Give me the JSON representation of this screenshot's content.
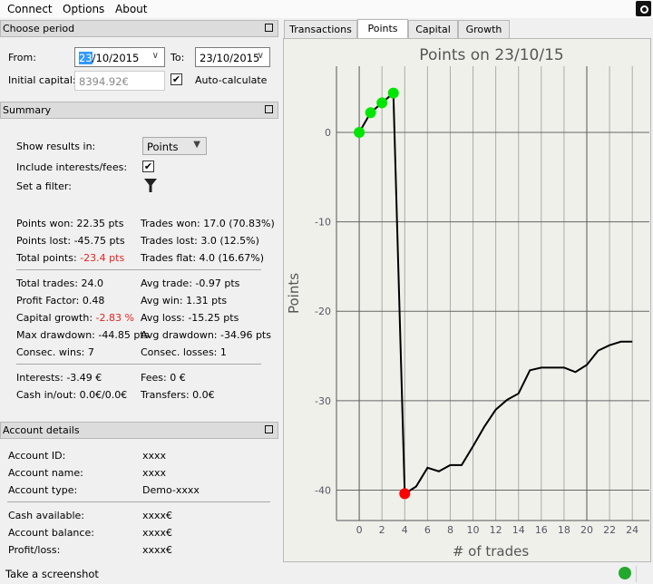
{
  "menu": {
    "items": [
      "Connect",
      "Options",
      "About"
    ]
  },
  "period": {
    "title": "Choose period",
    "from_label": "From:",
    "from_day": "23",
    "from_rest": "/10/2015",
    "to_label": "To:",
    "to_value": "23/10/2015",
    "capital_label": "Initial capital:",
    "capital_value": "8394.92€",
    "auto_label": "Auto-calculate",
    "auto_checked": true
  },
  "summary": {
    "title": "Summary",
    "show_label": "Show results in:",
    "show_value": "Points",
    "include_label": "Include interests/fees:",
    "filter_label": "Set a filter:",
    "stats": [
      {
        "l": "Points won: ",
        "v": "22.35 pts",
        "r": "Trades won: 17.0 (70.83%)"
      },
      {
        "l": "Points lost: ",
        "v": "-45.75 pts",
        "r": "Trades lost: 3.0 (12.5%)"
      },
      {
        "l": "Total points: ",
        "v": "-23.4 pts",
        "r": "Trades flat: 4.0 (16.67%)",
        "red": true
      },
      {
        "l": "Total trades: ",
        "v": "24.0",
        "r": "Avg trade: -0.97 pts"
      },
      {
        "l": "Profit Factor: ",
        "v": "0.48",
        "r": "Avg win: 1.31 pts"
      },
      {
        "l": "Capital growth: ",
        "v": "-2.83 %",
        "r": "Avg loss: -15.25 pts",
        "red": true
      },
      {
        "l": "Max drawdown: ",
        "v": "-44.85 pts",
        "r": "Avg drawdown: -34.96 pts"
      },
      {
        "l": "Consec. wins: ",
        "v": "7",
        "r": "Consec. losses: 1"
      },
      {
        "l": "Interests: ",
        "v": "-3.49 €",
        "r": "Fees: 0 €"
      },
      {
        "l": "Cash in/out: ",
        "v": "0.0€/0.0€",
        "r": "Transfers: 0.0€"
      }
    ]
  },
  "account": {
    "title": "Account details",
    "rows": [
      {
        "l": "Account ID:",
        "v": "xxxx"
      },
      {
        "l": "Account name:",
        "v": "xxxx"
      },
      {
        "l": "Account type:",
        "v": "Demo-xxxx"
      },
      {
        "l": "Cash available:",
        "v": "xxxx€"
      },
      {
        "l": "Account balance:",
        "v": "xxxx€"
      },
      {
        "l": "Profit/loss:",
        "v": "xxxx€"
      }
    ]
  },
  "status": {
    "screenshot_label": "Take a screenshot",
    "connected_color": "#22a82e"
  },
  "tabs": [
    "Transactions",
    "Points",
    "Capital",
    "Growth"
  ],
  "active_tab": "Points",
  "chart_data": {
    "type": "line",
    "title": "Points on 23/10/15",
    "xlabel": "# of trades",
    "ylabel": "Points",
    "x": [
      0,
      1,
      2,
      3,
      4,
      5,
      6,
      7,
      8,
      9,
      10,
      11,
      12,
      13,
      14,
      15,
      16,
      17,
      18,
      19,
      20,
      21,
      22,
      23,
      24
    ],
    "y": [
      0,
      2.2,
      3.3,
      4.4,
      -40.4,
      -39.6,
      -37.5,
      -37.9,
      -37.2,
      -37.2,
      -35.1,
      -32.9,
      -31.0,
      -29.9,
      -29.2,
      -26.6,
      -26.3,
      -26.3,
      -26.3,
      -26.8,
      -26.0,
      -24.4,
      -23.8,
      -23.4,
      -23.4
    ],
    "markers": [
      {
        "x": 0,
        "y": 0,
        "color": "#00e600"
      },
      {
        "x": 1,
        "y": 2.2,
        "color": "#00e600"
      },
      {
        "x": 2,
        "y": 3.3,
        "color": "#00e600"
      },
      {
        "x": 3,
        "y": 4.4,
        "color": "#00e600"
      },
      {
        "x": 4,
        "y": -40.4,
        "color": "#ff0000"
      }
    ],
    "xticks": [
      0,
      2,
      4,
      6,
      8,
      10,
      12,
      14,
      16,
      18,
      20,
      22,
      24
    ],
    "yticks": [
      0,
      -10,
      -20,
      -30,
      -40
    ],
    "xlim": [
      -2,
      25.5
    ],
    "ylim": [
      -43.4,
      7.4
    ],
    "grid": true
  }
}
